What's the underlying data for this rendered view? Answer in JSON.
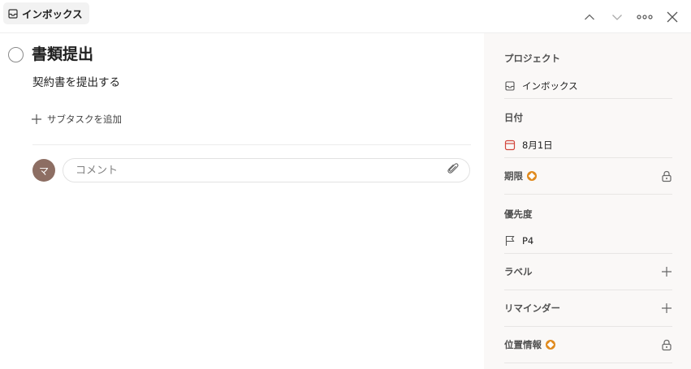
{
  "header": {
    "breadcrumb_label": "インボックス",
    "breadcrumb_icon": "inbox-icon",
    "actions": [
      "chevron-up-icon",
      "chevron-down-icon",
      "more-icon",
      "close-icon"
    ]
  },
  "task": {
    "title": "書類提出",
    "description": "契約書を提出する",
    "add_subtask_label": "サブタスクを追加"
  },
  "comment": {
    "avatar_initial": "マ",
    "placeholder": "コメント"
  },
  "sidebar": {
    "project": {
      "label": "プロジェクト",
      "value": "インボックス",
      "icon": "inbox-icon"
    },
    "date": {
      "label": "日付",
      "value": "8月1日",
      "icon": "calendar-icon",
      "color": "#d1453b"
    },
    "deadline": {
      "label": "期限",
      "icon": "lock-icon"
    },
    "priority": {
      "label": "優先度",
      "value": "P4",
      "icon": "flag-icon"
    },
    "labels": {
      "label": "ラベル",
      "icon": "plus-icon"
    },
    "reminders": {
      "label": "リマインダー",
      "icon": "plus-icon"
    },
    "location": {
      "label": "位置情報",
      "icon": "lock-icon"
    }
  },
  "colors": {
    "sidebar_bg": "#faf8f7",
    "premium_badge": "#e08a1e",
    "avatar_bg": "#8d6e63",
    "date_accent": "#d1453b"
  }
}
